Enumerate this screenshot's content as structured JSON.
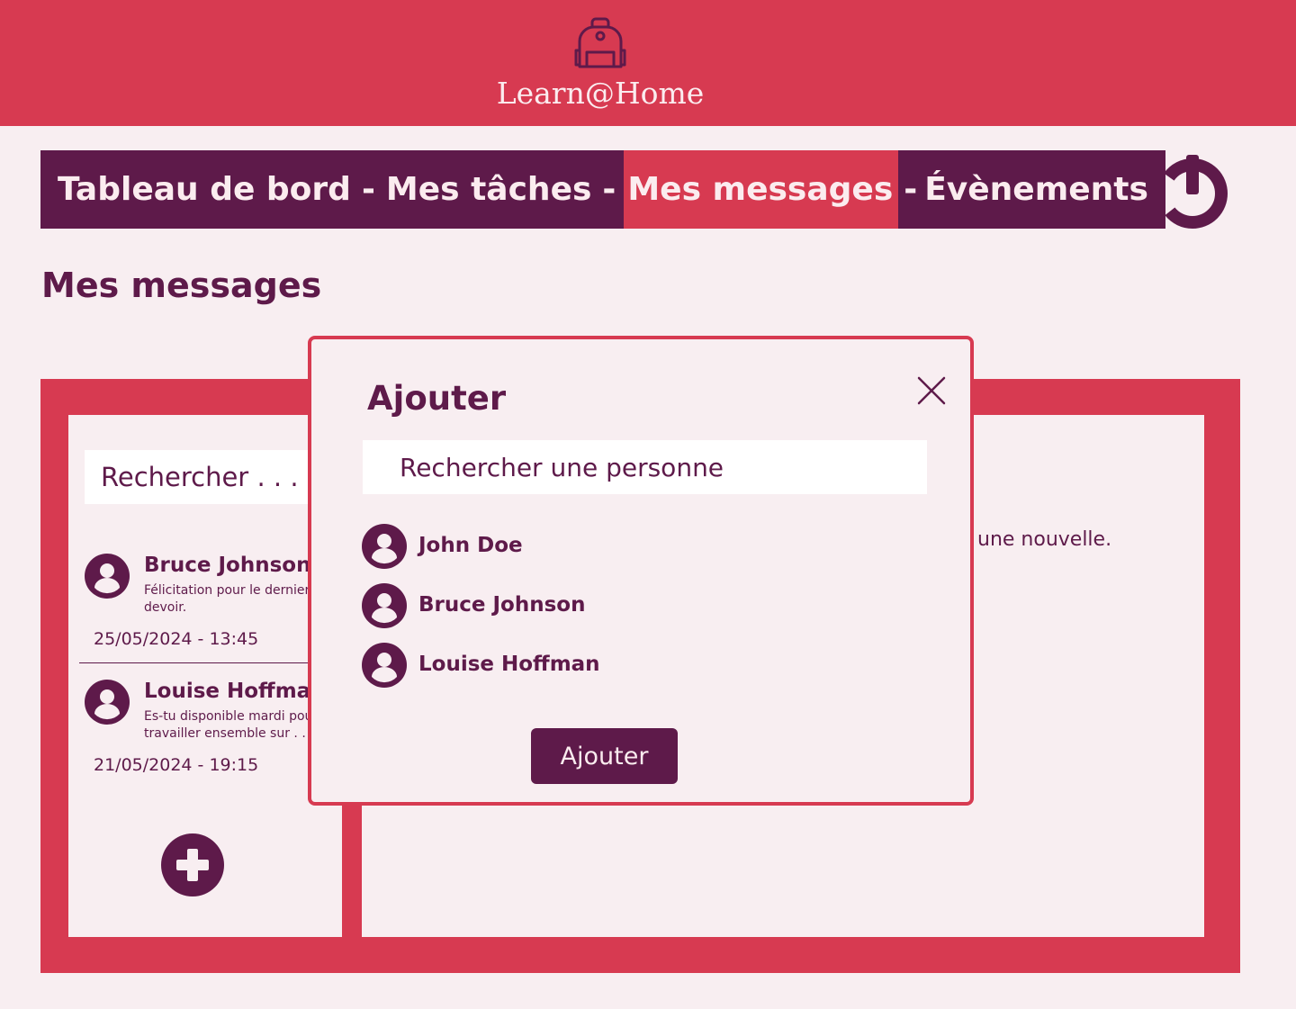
{
  "header": {
    "app_name": "Learn@Home",
    "logo_icon": "backpack-icon"
  },
  "nav": {
    "items": [
      {
        "label": "Tableau de bord",
        "active": false
      },
      {
        "label": "Mes tâches",
        "active": false
      },
      {
        "label": "Mes messages",
        "active": true
      },
      {
        "label": "Évènements",
        "active": false
      }
    ],
    "separator": "-",
    "logout_icon": "power-icon"
  },
  "page": {
    "title": "Mes messages"
  },
  "conversations": {
    "search_placeholder": "Rechercher . . .",
    "items": [
      {
        "name": "Bruce Johnson",
        "preview": "Félicitation pour le dernier devoir.",
        "date": "25/05/2024 - 13:45"
      },
      {
        "name": "Louise Hoffman",
        "preview": "Es-tu disponible mardi pour travailler ensemble sur . . .",
        "date": "21/05/2024 - 19:15"
      }
    ],
    "add_icon": "plus-icon"
  },
  "main_panel": {
    "hint_text": "une nouvelle."
  },
  "modal": {
    "title": "Ajouter",
    "search_placeholder": "Rechercher une personne",
    "people": [
      {
        "name": "John Doe"
      },
      {
        "name": "Bruce Johnson"
      },
      {
        "name": "Louise Hoffman"
      }
    ],
    "submit_label": "Ajouter",
    "close_icon": "close-icon"
  },
  "colors": {
    "primary_red": "#d73a51",
    "dark_purple": "#5e1a4a",
    "background": "#f8eef1",
    "light_text": "#fbecef"
  }
}
